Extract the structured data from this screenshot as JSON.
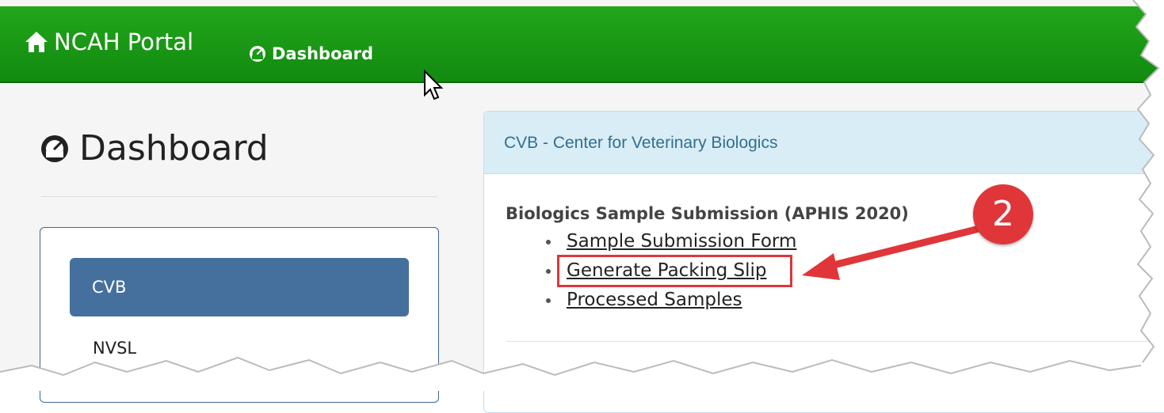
{
  "navbar": {
    "brand_label": "NCAH Portal",
    "brand_icon": "home-icon",
    "dashboard_link": "Dashboard",
    "dashboard_icon": "dashboard-gauge-icon",
    "color": "#1a9a16"
  },
  "page": {
    "title": "Dashboard",
    "title_icon": "dashboard-gauge-icon"
  },
  "sidebar": {
    "items": [
      {
        "label": "CVB",
        "active": true
      },
      {
        "label": "NVSL",
        "active": false
      }
    ],
    "active_color": "#45709e"
  },
  "card": {
    "header": "CVB - Center for Veterinary Biologics",
    "header_color": "#d9edf7",
    "section_title": "Biologics Sample Submission (APHIS 2020)",
    "links": [
      {
        "label": "Sample Submission Form"
      },
      {
        "label": "Generate Packing Slip"
      },
      {
        "label": "Processed Samples"
      }
    ]
  },
  "annotation": {
    "step_number": "2",
    "color": "#e0363a"
  }
}
